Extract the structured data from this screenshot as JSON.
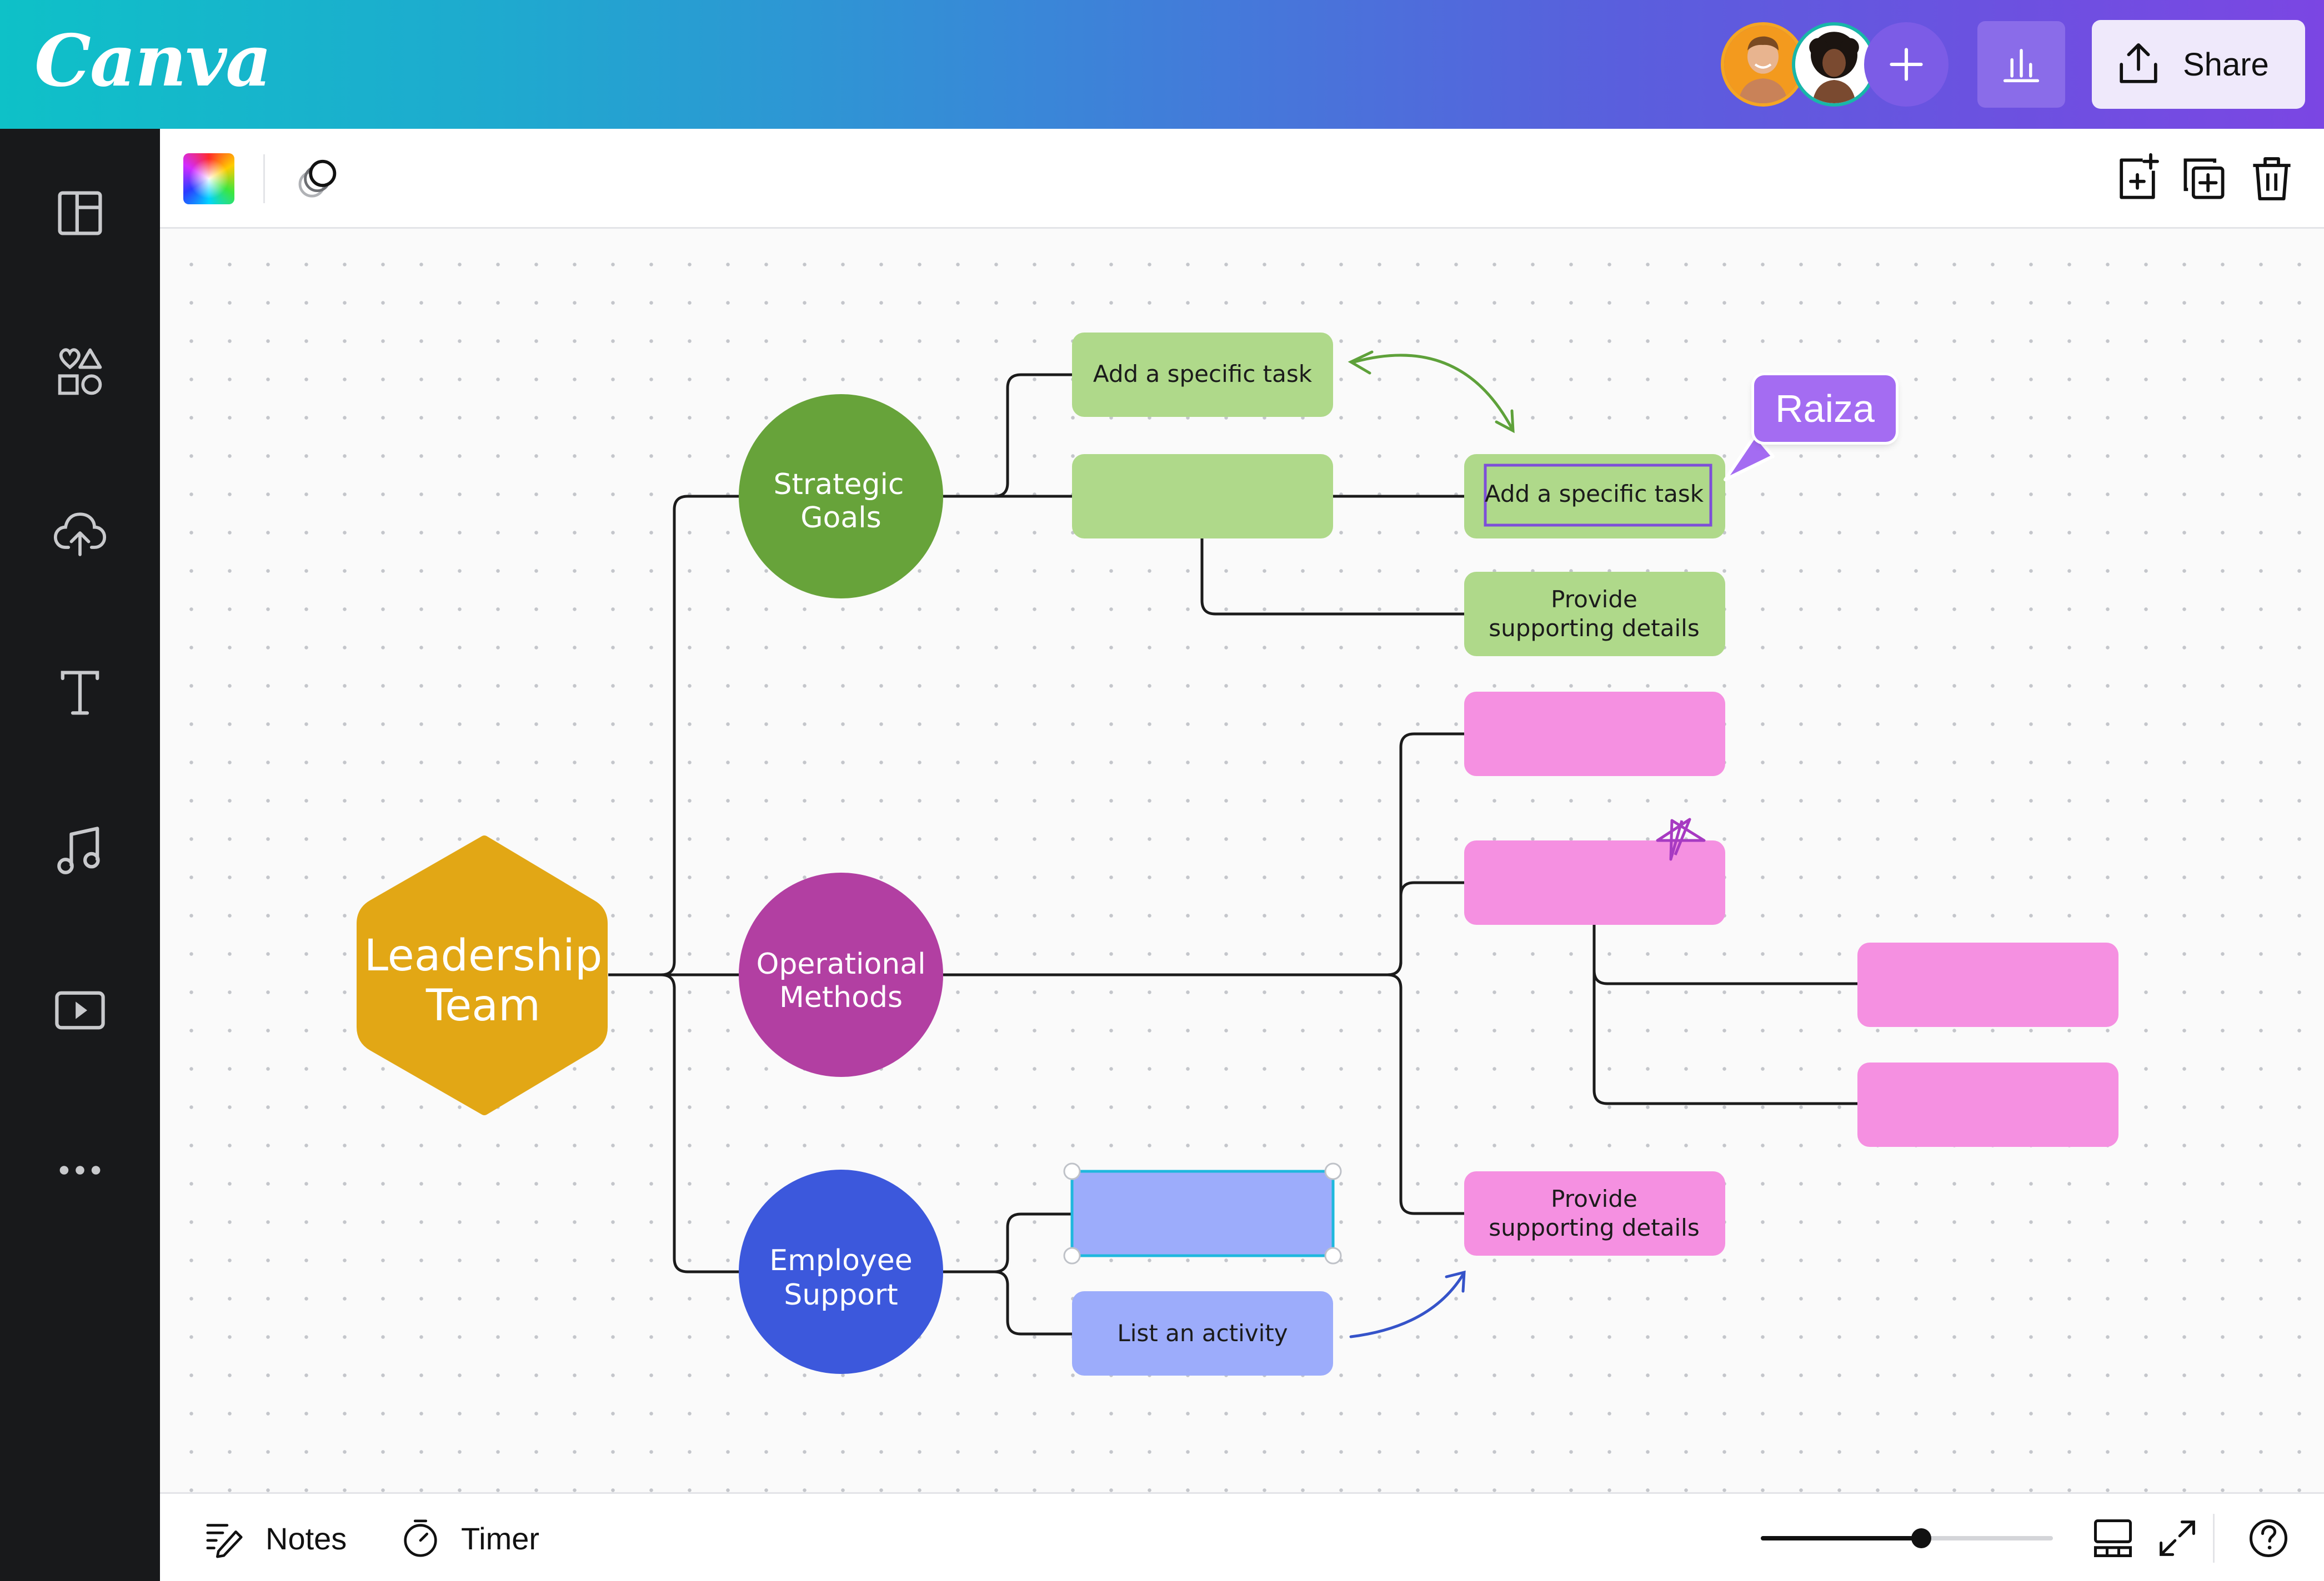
{
  "app": {
    "logo_text": "Canva"
  },
  "header": {
    "collaborators": [
      "collaborator-avatar-man",
      "collaborator-avatar-woman"
    ],
    "share_label": "Share",
    "colors": {
      "gradient_start": "#0ec1c8",
      "gradient_end": "#7b46e3"
    }
  },
  "sidebar": {
    "items": [
      {
        "icon": "templates-layout-icon"
      },
      {
        "icon": "elements-shapes-icon"
      },
      {
        "icon": "uploads-cloud-icon"
      },
      {
        "icon": "text-icon"
      },
      {
        "icon": "audio-music-icon"
      },
      {
        "icon": "videos-play-icon"
      },
      {
        "icon": "more-dots-icon"
      }
    ]
  },
  "toolbar": {
    "left_icons": [
      "color-picker-icon",
      "transparency-icon"
    ],
    "right_icons": [
      "add-page-icon",
      "duplicate-icon",
      "delete-icon"
    ]
  },
  "mindmap": {
    "root": {
      "label_line1": "Leadership",
      "label_line2": "Team",
      "color": "#e2a715"
    },
    "branches": [
      {
        "label_line1": "Strategic",
        "label_line2": "Goals",
        "color": "#67a33a"
      },
      {
        "label_line1": "Operational",
        "label_line2": "Methods",
        "color": "#b23fa2"
      },
      {
        "label_line1": "Employee",
        "label_line2": "Support",
        "color": "#3c58dc"
      }
    ],
    "green_boxes": {
      "color": "#afd98a",
      "task_top": "Add a specific task",
      "task_selected": "Add a specific task",
      "details_line1": "Provide",
      "details_line2": "supporting details"
    },
    "pink_boxes": {
      "color": "#f590e1",
      "details_line1": "Provide",
      "details_line2": "supporting details"
    },
    "blue_boxes": {
      "color": "#9cacfb",
      "activity": "List an activity"
    }
  },
  "cursor": {
    "name": "Raiza",
    "color": "#a46cf2"
  },
  "bottombar": {
    "notes_label": "Notes",
    "timer_label": "Timer",
    "zoom_level": 0.55
  }
}
